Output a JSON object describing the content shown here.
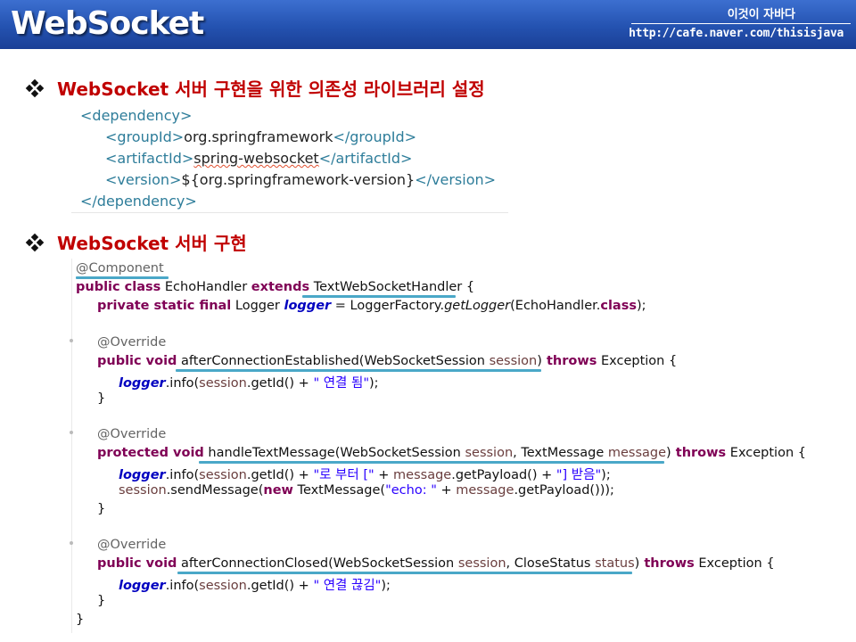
{
  "header": {
    "title": "WebSocket",
    "cafe_name": "이것이 자바다",
    "cafe_url": "http://cafe.naver.com/thisisjava"
  },
  "section1": {
    "heading": "WebSocket 서버 구현을 위한 의존성 라이브러리 설정",
    "xml": {
      "dep_open": "<dependency>",
      "gid_open": "<groupId>",
      "gid_val": "org.springframework",
      "gid_close": "</groupId>",
      "aid_open": "<artifactId>",
      "aid_val": "spring-websocket",
      "aid_close": "</artifactId>",
      "ver_open": "<version>",
      "ver_val": "${org.springframework-version}",
      "ver_close": "</version>",
      "dep_close": "</dependency>"
    }
  },
  "section2": {
    "heading": "WebSocket 서버 구현",
    "code": {
      "l1": "@Component",
      "l2_kw": "public class",
      "l2_name": " EchoHandler ",
      "l2_ext": "extends",
      "l2_sup": " TextWebSocketHandler",
      "l2_end": " {",
      "l3_kw": "private static final",
      "l3_type": " Logger ",
      "l3_fld": "logger",
      "l3_eq": " = LoggerFactory.",
      "l3_m": "getLogger",
      "l3_arg": "(EchoHandler.",
      "l3_class": "class",
      "l3_end": ");",
      "l4": "@Override",
      "l5_kw": "public void",
      "l5_m": " afterConnectionEstablished(WebSocketSession ",
      "l5_p": "session",
      "l5_close": ")",
      "l5_throws": " throws",
      "l5_end": " Exception {",
      "l6_fld": "logger",
      "l6_a": ".info(",
      "l6_p": "session",
      "l6_b": ".getId() + ",
      "l6_str": "\" 연결 됨\"",
      "l6_end": ");",
      "l7": "}",
      "l8": "@Override",
      "l9_kw": "protected void",
      "l9_m": " handleTextMessage(WebSocketSession ",
      "l9_p1": "session",
      "l9_c": ", TextMessage ",
      "l9_p2": "message",
      "l9_close": ")",
      "l9_throws": " throws",
      "l9_end": " Exception {",
      "l10_fld": "logger",
      "l10_a": ".info(",
      "l10_p": "session",
      "l10_b": ".getId() + ",
      "l10_s1": "\"로 부터 [\"",
      "l10_c": " + ",
      "l10_p2": "message",
      "l10_d": ".getPayload() + ",
      "l10_s2": "\"] 받음\"",
      "l10_end": ");",
      "l11_p": "session",
      "l11_a": ".sendMessage(",
      "l11_kw": "new",
      "l11_b": " TextMessage(",
      "l11_str": "\"echo: \"",
      "l11_c": " + ",
      "l11_p2": "message",
      "l11_end": ".getPayload()));",
      "l12": "}",
      "l13": "@Override",
      "l14_kw": "public void",
      "l14_m": " afterConnectionClosed(WebSocketSession ",
      "l14_p1": "session",
      "l14_c": ", CloseStatus ",
      "l14_p2": "status",
      "l14_close": ")",
      "l14_throws": " throws",
      "l14_end": " Exception {",
      "l15_fld": "logger",
      "l15_a": ".info(",
      "l15_p": "session",
      "l15_b": ".getId() + ",
      "l15_str": "\" 연결 끊김\"",
      "l15_end": ");",
      "l16": "}",
      "l17": "}"
    }
  },
  "colors": {
    "header_blue": "#2452b0",
    "heading_red": "#c00000",
    "underline": "#4aa8c8",
    "keyword": "#7f0055",
    "string": "#2a00ff"
  }
}
